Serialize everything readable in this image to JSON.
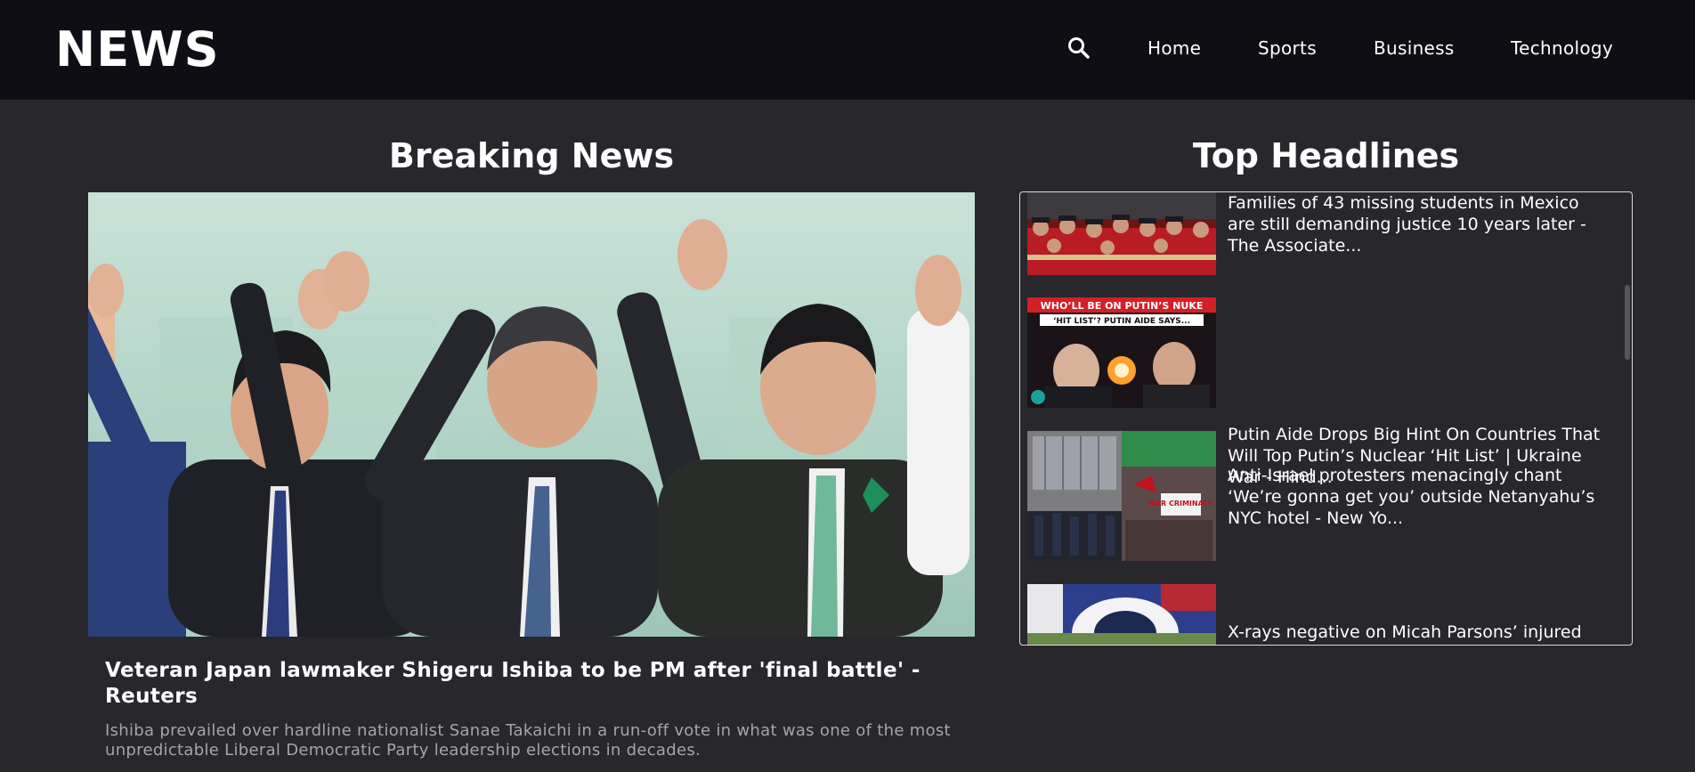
{
  "header": {
    "logo": "NEWS",
    "nav": [
      "Home",
      "Sports",
      "Business",
      "Technology"
    ],
    "search_icon": "search-icon"
  },
  "breaking": {
    "heading": "Breaking News",
    "title": "Veteran Japan lawmaker Shigeru Ishiba to be PM after 'final battle' - Reuters",
    "description": "Ishiba prevailed over hardline nationalist Sanae Takaichi in a run-off vote in what was one of the most unpredictable Liberal Democratic Party leadership elections in decades."
  },
  "top_headlines": {
    "heading": "Top Headlines",
    "items": [
      {
        "title": "Families of 43 missing students in Mexico are still demanding justice 10 years later - The Associate..."
      },
      {
        "title": "Putin Aide Drops Big Hint On Countries That Will Top Putin’s Nuclear ‘Hit List’ | Ukraine War - Hind...",
        "thumb_banner": "WHO’LL BE ON PUTIN’S NUKE",
        "thumb_sub": "‘HIT LIST’? PUTIN AIDE SAYS..."
      },
      {
        "title": "Anti-Israel protesters menacingly chant ‘We’re gonna get you’ outside Netanyahu’s NYC hotel - New Yo...",
        "thumb_sign": "WAR CRIMINALS"
      },
      {
        "title": "X-rays negative on Micah Parsons’ injured"
      }
    ]
  },
  "colors": {
    "topbar": "#0e0e14",
    "background": "#27272c",
    "muted_text": "#a4a4aa",
    "border": "#d8d8de"
  }
}
